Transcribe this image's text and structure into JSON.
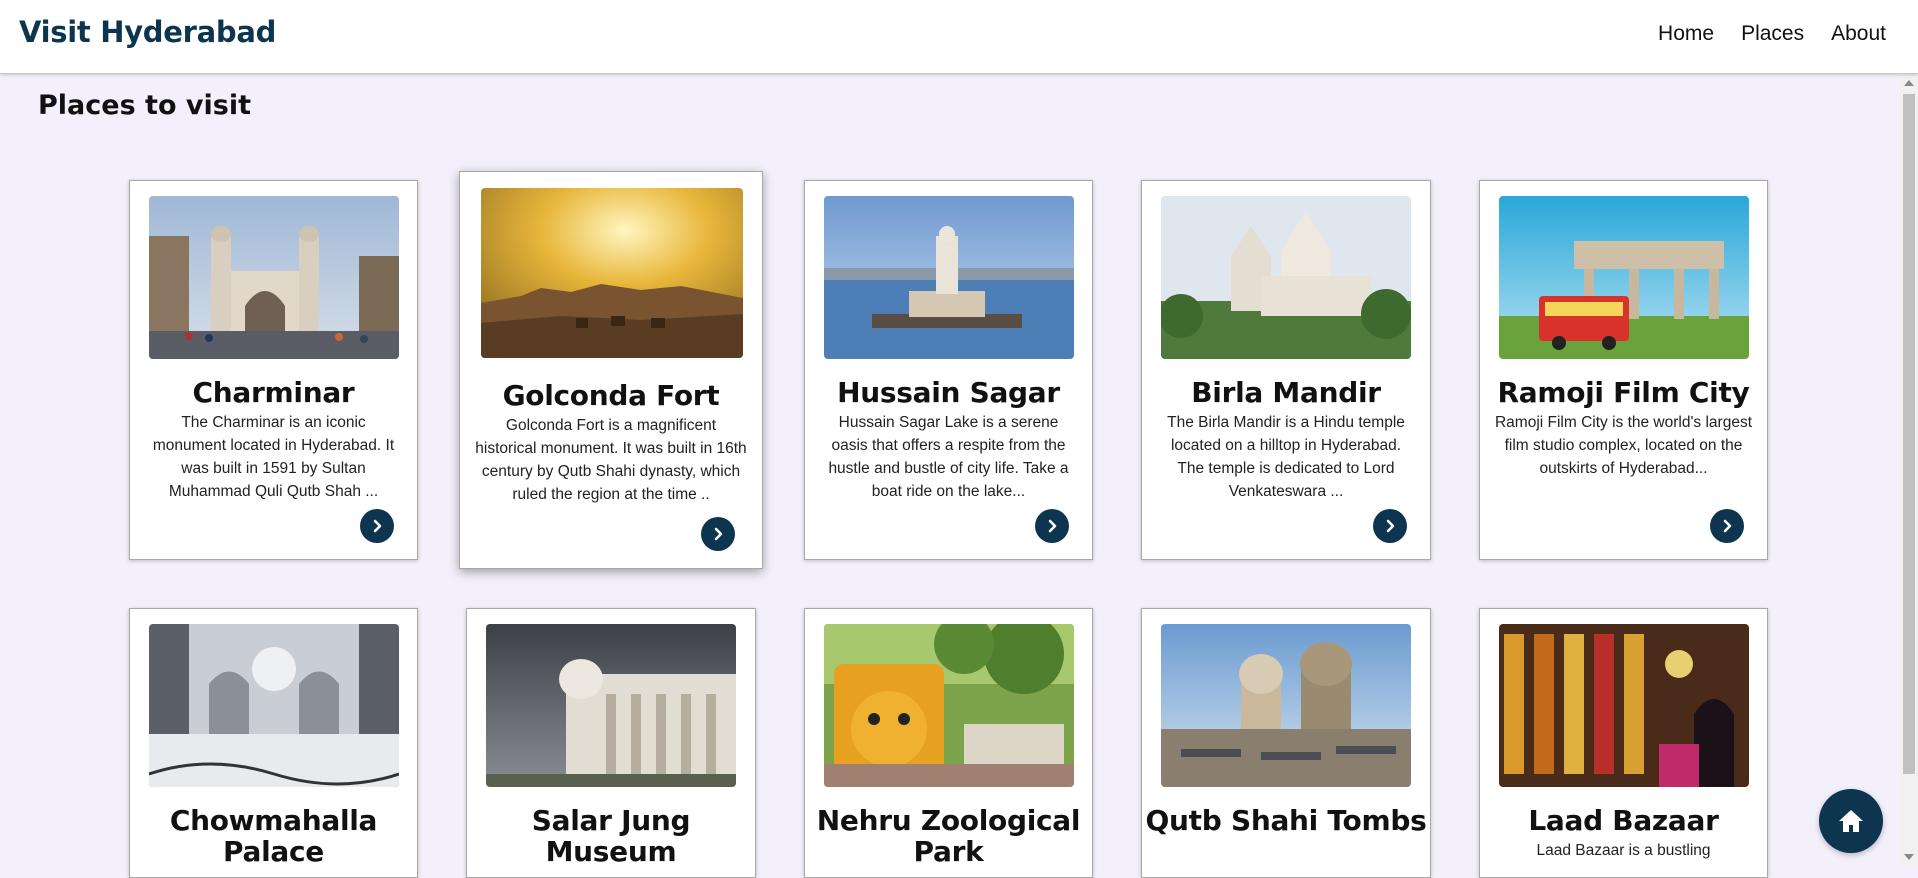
{
  "navbar": {
    "brand": "Visit Hyderabad",
    "links": [
      "Home",
      "Places",
      "About"
    ]
  },
  "page_title": "Places to visit",
  "cards": [
    {
      "title": "Charminar",
      "description": "The Charminar is an iconic monument located in Hyderabad. It was built in 1591 by Sultan Muhammad Quli Qutb Shah ..."
    },
    {
      "title": "Golconda Fort",
      "description": "Golconda Fort is a magnificent historical monument. It was built in 16th century by Qutb Shahi dynasty, which ruled the region at the time .."
    },
    {
      "title": "Hussain Sagar",
      "description": "Hussain Sagar Lake is a serene oasis that offers a respite from the hustle and bustle of city life. Take a boat ride on the lake..."
    },
    {
      "title": "Birla Mandir",
      "description": "The Birla Mandir is a Hindu temple located on a hilltop in Hyderabad. The temple is dedicated to Lord Venkateswara ..."
    },
    {
      "title": "Ramoji Film City",
      "description": "Ramoji Film City is the world's largest film studio complex, located on the outskirts of Hyderabad..."
    },
    {
      "title": "Chowmahalla Palace",
      "description": ""
    },
    {
      "title": "Salar Jung Museum",
      "description": ""
    },
    {
      "title": "Nehru Zoological Park",
      "description": ""
    },
    {
      "title": "Qutb Shahi Tombs",
      "description": ""
    },
    {
      "title": "Laad Bazaar",
      "description": "Laad Bazaar is a bustling"
    }
  ],
  "icons": {
    "card_button": "chevron-right-icon",
    "fab": "home-icon"
  },
  "colors": {
    "brand": "#0e3550",
    "page_background": "#f4f0fb"
  }
}
